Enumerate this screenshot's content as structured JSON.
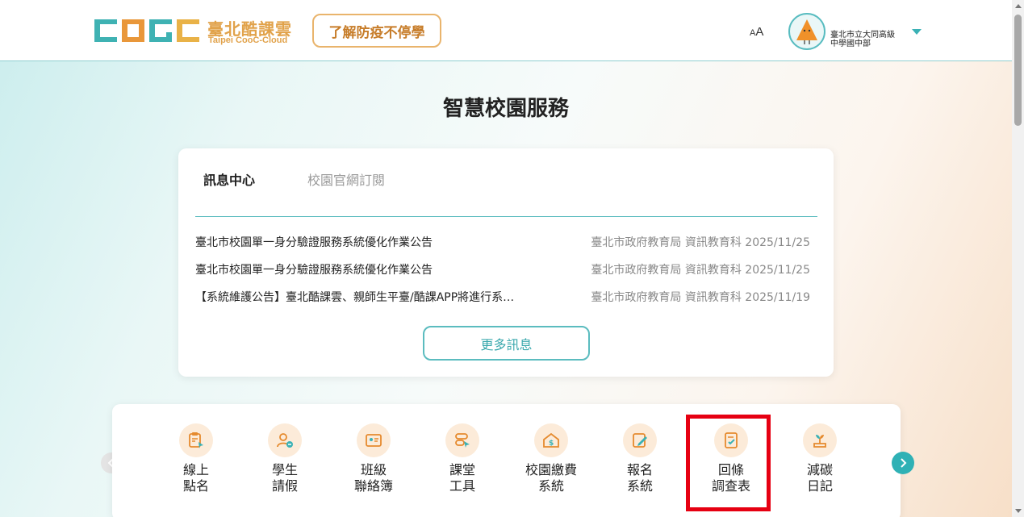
{
  "header": {
    "logo_title": "臺北酷課雲",
    "logo_subtitle": "Taipei CooC-Cloud",
    "covid_button": "了解防疫不停學",
    "font_size_big": "A",
    "font_size_small": "A",
    "school_line1": "臺北市立大同高級",
    "school_line2": "中學國中部"
  },
  "page_title": "智慧校園服務",
  "news": {
    "tabs": [
      "訊息中心",
      "校園官網訂閱"
    ],
    "items": [
      {
        "title": "臺北市校園單一身分驗證服務系統優化作業公告",
        "source": "臺北市政府教育局 資訊教育科 2025/11/25"
      },
      {
        "title": "臺北市校園單一身分驗證服務系統優化作業公告",
        "source": "臺北市政府教育局 資訊教育科 2025/11/25"
      },
      {
        "title": "【系統維護公告】臺北酷課雲、親師生平臺/酷課APP將進行系…",
        "source": "臺北市政府教育局 資訊教育科 2025/11/19"
      }
    ],
    "more_button": "更多訊息"
  },
  "services": [
    {
      "line1": "線上",
      "line2": "點名",
      "icon": "roll-call-icon"
    },
    {
      "line1": "學生",
      "line2": "請假",
      "icon": "student-leave-icon"
    },
    {
      "line1": "班級",
      "line2": "聯絡簿",
      "icon": "contact-book-icon"
    },
    {
      "line1": "課堂",
      "line2": "工具",
      "icon": "class-tools-icon"
    },
    {
      "line1": "校園繳費",
      "line2": "系統",
      "icon": "payment-icon"
    },
    {
      "line1": "報名",
      "line2": "系統",
      "icon": "registration-icon"
    },
    {
      "line1": "回條",
      "line2": "調查表",
      "icon": "survey-icon"
    },
    {
      "line1": "減碳",
      "line2": "日記",
      "icon": "carbon-diary-icon"
    }
  ],
  "colors": {
    "accent": "#3ab1b5",
    "icon_orange": "#e58a2e",
    "highlight": "#e60012"
  }
}
